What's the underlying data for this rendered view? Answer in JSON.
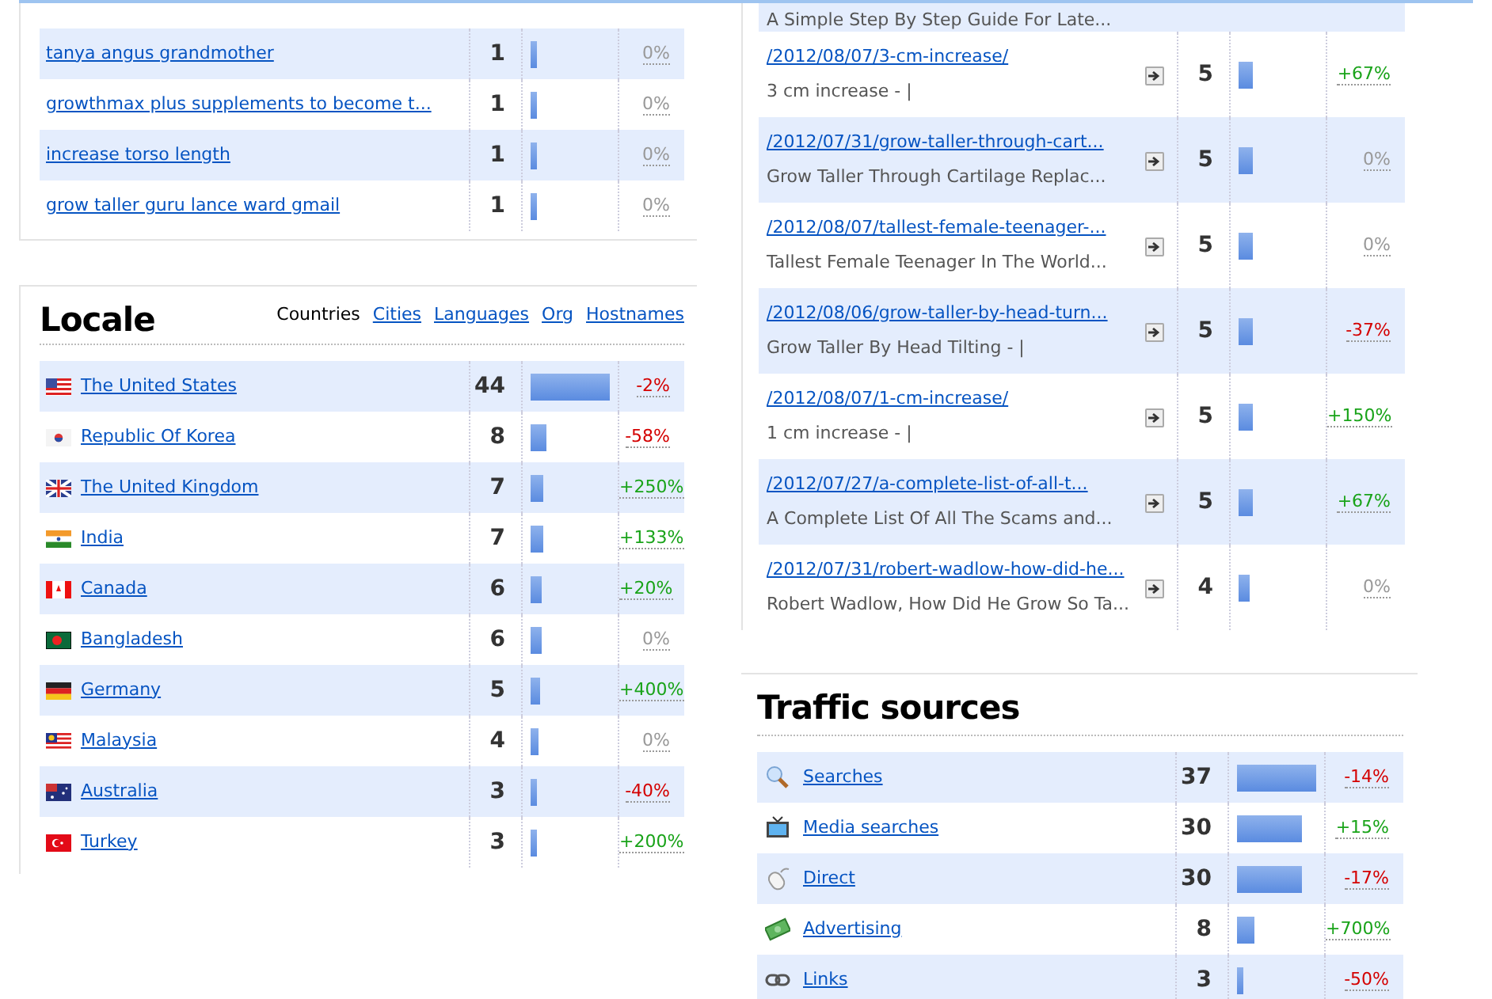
{
  "keywords": {
    "rows": [
      {
        "label": "tanya angus grandmother",
        "count": "1",
        "level": 0.08,
        "change": "0%",
        "color": "#999999"
      },
      {
        "label": "growthmax plus supplements to become t...",
        "count": "1",
        "level": 0.08,
        "change": "0%",
        "color": "#999999"
      },
      {
        "label": "increase torso length",
        "count": "1",
        "level": 0.08,
        "change": "0%",
        "color": "#999999"
      },
      {
        "label": "grow taller guru lance ward gmail",
        "count": "1",
        "level": 0.08,
        "change": "0%",
        "color": "#999999"
      }
    ]
  },
  "locale": {
    "title": "Locale",
    "tabs": [
      {
        "label": "Countries",
        "selected": true
      },
      {
        "label": "Cities",
        "selected": false
      },
      {
        "label": "Languages",
        "selected": false
      },
      {
        "label": "Org",
        "selected": false
      },
      {
        "label": "Hostnames",
        "selected": false
      }
    ],
    "rows": [
      {
        "label": "The United States",
        "count": "44",
        "level": 1.0,
        "change": "-2%",
        "color": "#d40000"
      },
      {
        "label": "Republic Of Korea",
        "count": "8",
        "level": 0.2,
        "change": "-58%",
        "color": "#d40000"
      },
      {
        "label": "The United Kingdom",
        "count": "7",
        "level": 0.16,
        "change": "+250%",
        "color": "#19a319"
      },
      {
        "label": "India",
        "count": "7",
        "level": 0.16,
        "change": "+133%",
        "color": "#19a319"
      },
      {
        "label": "Canada",
        "count": "6",
        "level": 0.14,
        "change": "+20%",
        "color": "#19a319"
      },
      {
        "label": "Bangladesh",
        "count": "6",
        "level": 0.14,
        "change": "0%",
        "color": "#999999"
      },
      {
        "label": "Germany",
        "count": "5",
        "level": 0.12,
        "change": "+400%",
        "color": "#19a319"
      },
      {
        "label": "Malaysia",
        "count": "4",
        "level": 0.1,
        "change": "0%",
        "color": "#999999"
      },
      {
        "label": "Australia",
        "count": "3",
        "level": 0.08,
        "change": "-40%",
        "color": "#d40000"
      },
      {
        "label": "Turkey",
        "count": "3",
        "level": 0.08,
        "change": "+200%",
        "color": "#19a319"
      }
    ]
  },
  "pages": {
    "partial_description": "A Simple Step By Step Guide For Late...",
    "rows": [
      {
        "path": "/2012/08/07/3-cm-increase/",
        "description": "3 cm increase - |",
        "count": "5",
        "level": 0.18,
        "change": "+67%",
        "color": "#19a319"
      },
      {
        "path": "/2012/07/31/grow-taller-through-cart...",
        "description": "Grow Taller Through Cartilage Replac...",
        "count": "5",
        "level": 0.18,
        "change": "0%",
        "color": "#999999"
      },
      {
        "path": "/2012/08/07/tallest-female-teenager-...",
        "description": "Tallest Female Teenager In The World...",
        "count": "5",
        "level": 0.18,
        "change": "0%",
        "color": "#999999"
      },
      {
        "path": "/2012/08/06/grow-taller-by-head-turn...",
        "description": "Grow Taller By Head Tilting - |",
        "count": "5",
        "level": 0.18,
        "change": "-37%",
        "color": "#d40000"
      },
      {
        "path": "/2012/08/07/1-cm-increase/",
        "description": "1 cm increase - |",
        "count": "5",
        "level": 0.18,
        "change": "+150%",
        "color": "#19a319"
      },
      {
        "path": "/2012/07/27/a-complete-list-of-all-t...",
        "description": "A Complete List Of All The Scams and...",
        "count": "5",
        "level": 0.18,
        "change": "+67%",
        "color": "#19a319"
      },
      {
        "path": "/2012/07/31/robert-wadlow-how-did-he...",
        "description": "Robert Wadlow, How Did He Grow So Ta...",
        "count": "4",
        "level": 0.14,
        "change": "0%",
        "color": "#999999"
      }
    ]
  },
  "traffic_sources": {
    "title": "Traffic sources",
    "rows": [
      {
        "label": "Searches",
        "count": "37",
        "level": 1.0,
        "change": "-14%",
        "color": "#d40000"
      },
      {
        "label": "Media searches",
        "count": "30",
        "level": 0.82,
        "change": "+15%",
        "color": "#19a319"
      },
      {
        "label": "Direct",
        "count": "30",
        "level": 0.82,
        "change": "-17%",
        "color": "#d40000"
      },
      {
        "label": "Advertising",
        "count": "8",
        "level": 0.22,
        "change": "+700%",
        "color": "#19a319"
      },
      {
        "label": "Links",
        "count": "3",
        "level": 0.08,
        "change": "-50%",
        "color": "#d40000"
      }
    ]
  }
}
